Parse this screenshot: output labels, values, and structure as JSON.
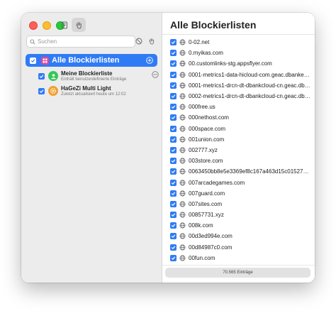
{
  "sidebar": {
    "search_placeholder": "Suchen",
    "all_lists": {
      "label": "Alle Blockierlisten",
      "checked": true
    },
    "lists": [
      {
        "name": "Meine Blockierliste",
        "subtitle": "Enthält benutzerdefinierte Einträge",
        "icon": "person-icon",
        "color": "#34c759",
        "checked": true
      },
      {
        "name": "HaGeZi Multi Light",
        "subtitle": "Zuletzt aktualisiert heute um 12:02",
        "icon": "gear-icon",
        "color": "#f0a030",
        "checked": true
      }
    ]
  },
  "main": {
    "title": "Alle Blockierlisten",
    "entries": [
      "0-02.net",
      "0.myikas.com",
      "00.customlinks-stg.appsflyer.com",
      "0001-metrics1-data-hicloud-com.geac.dbanked...",
      "0001-metrics1-drcn-dt-dbankcloud-cn.geac.dba...",
      "0002-metrics1-drcn-dt-dbankcloud-cn.geac.dba...",
      "000free.us",
      "000nethost.com",
      "000space.com",
      "001union.com",
      "002777.xyz",
      "003store.com",
      "0063450bb8e5e3369ef8c167a463d15c015272...",
      "007arcadegames.com",
      "007guard.com",
      "007sites.com",
      "00857731.xyz",
      "008k.com",
      "00d3ed994e.com",
      "00d84987c0.com",
      "00fun.com"
    ],
    "footer": "70.565 Einträge"
  },
  "colors": {
    "accent": "#2f7bf5",
    "grid_icon": "#e0459a"
  }
}
